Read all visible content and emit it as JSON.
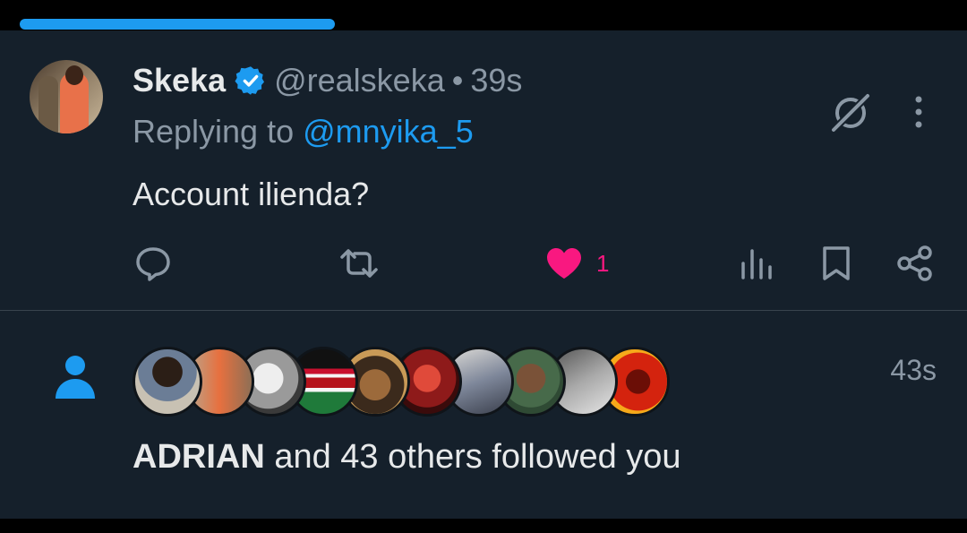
{
  "loading": {
    "progress": 0.34
  },
  "tweet": {
    "display_name": "Skeka",
    "handle": "@realskeka",
    "separator": "•",
    "time": "39s",
    "reply_prefix": "Replying to",
    "reply_handle": "@mnyika_5",
    "text": "Account ilienda?",
    "like_count": "1",
    "liked": true
  },
  "icons": {
    "verified": "verified-badge-icon",
    "grok": "grok-icon",
    "more": "more-vertical-icon",
    "reply": "reply-icon",
    "retweet": "retweet-icon",
    "like": "heart-filled-icon",
    "views": "views-icon",
    "bookmark": "bookmark-icon",
    "share": "share-icon",
    "follow": "person-icon"
  },
  "notification": {
    "name": "ADRIAN",
    "rest": " and 43 others followed you",
    "time": "43s"
  },
  "colors": {
    "background": "#15202b",
    "accent": "#1d9bf0",
    "like": "#f91880",
    "primary_text": "#e7e9ea",
    "secondary_text": "#8b98a5"
  }
}
